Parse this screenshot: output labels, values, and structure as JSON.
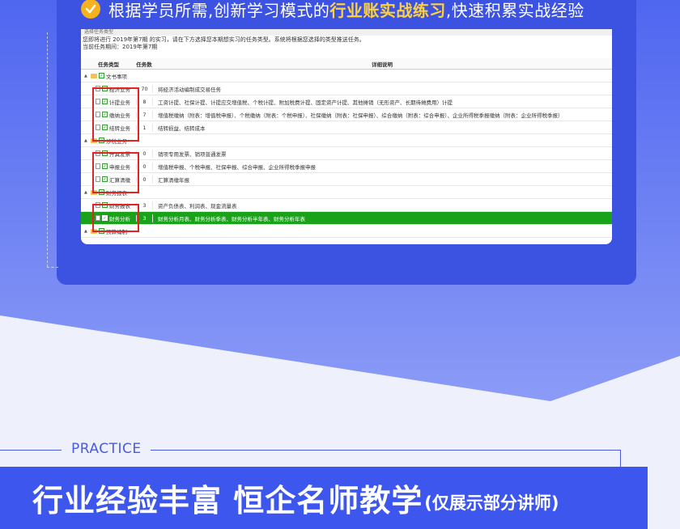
{
  "headline": {
    "prefix": "根据学员所需,创新学习模式的",
    "highlight": "行业账实战练习",
    "suffix": ",快速积累实战经验"
  },
  "window": {
    "title": "选择任务类型",
    "info_line1": "您即将进行 2019年第7期 的实习，请在下方选择您本期想实习的任务类型。系统将根据您选择的类型推送任务。",
    "info_line2": "当前任务期间：2019年第7期",
    "headers": {
      "type": "任务类型",
      "count": "任务数",
      "detail": "详细说明"
    },
    "groups": [
      {
        "name": "文书事项",
        "rows": [
          {
            "type": "经济业务",
            "count": "70",
            "detail": "将经济活动编制成交易任务"
          },
          {
            "type": "计提业务",
            "count": "8",
            "detail": "工资计提、社保计提、计提应交增值税、个税计提、附加税费计提、固定资产计提、其他摊销（无形资产、长期待摊费用）计提"
          },
          {
            "type": "缴纳业务",
            "count": "7",
            "detail": "增值税缴纳（附表：增值税申报）、个税缴纳（附表：个税申报）、社保缴纳（附表：社保申报）、综合缴纳（附表：综合申报）、企业所得税季报缴纳（附表：企业所得税季报）"
          },
          {
            "type": "结转业务",
            "count": "1",
            "detail": "结转损益、结转成本"
          }
        ]
      },
      {
        "name": "涉税业务",
        "rows": [
          {
            "type": "开具发票",
            "count": "0",
            "detail": "销项专用发票、销项普通发票"
          },
          {
            "type": "申报业务",
            "count": "0",
            "detail": "增值税申报、个税申报、社保申报、综合申报、企业所得税季报申报"
          },
          {
            "type": "汇算清缴",
            "count": "0",
            "detail": "汇算清缴年报"
          }
        ]
      },
      {
        "name": "财务报表",
        "rows": [
          {
            "type": "财务报表",
            "count": "3",
            "detail": "资产负债表、利润表、现金流量表"
          },
          {
            "type": "财务分析",
            "count": "3",
            "detail": "财务分析月表、财务分析季表、财务分析半年表、财务分析年表",
            "selected": true
          }
        ]
      },
      {
        "name": "预算编制",
        "rows": []
      }
    ]
  },
  "practice": {
    "label": "PRACTICE"
  },
  "banner": {
    "main": "行业经验丰富  恒企名师教学",
    "sub": "(仅展示部分讲师)"
  },
  "colors": {
    "panel": "#3c52e0",
    "highlight": "#ffd23c",
    "selected_row": "#1aa31a",
    "red_box": "#e02424",
    "banner": "#3d57ee"
  }
}
